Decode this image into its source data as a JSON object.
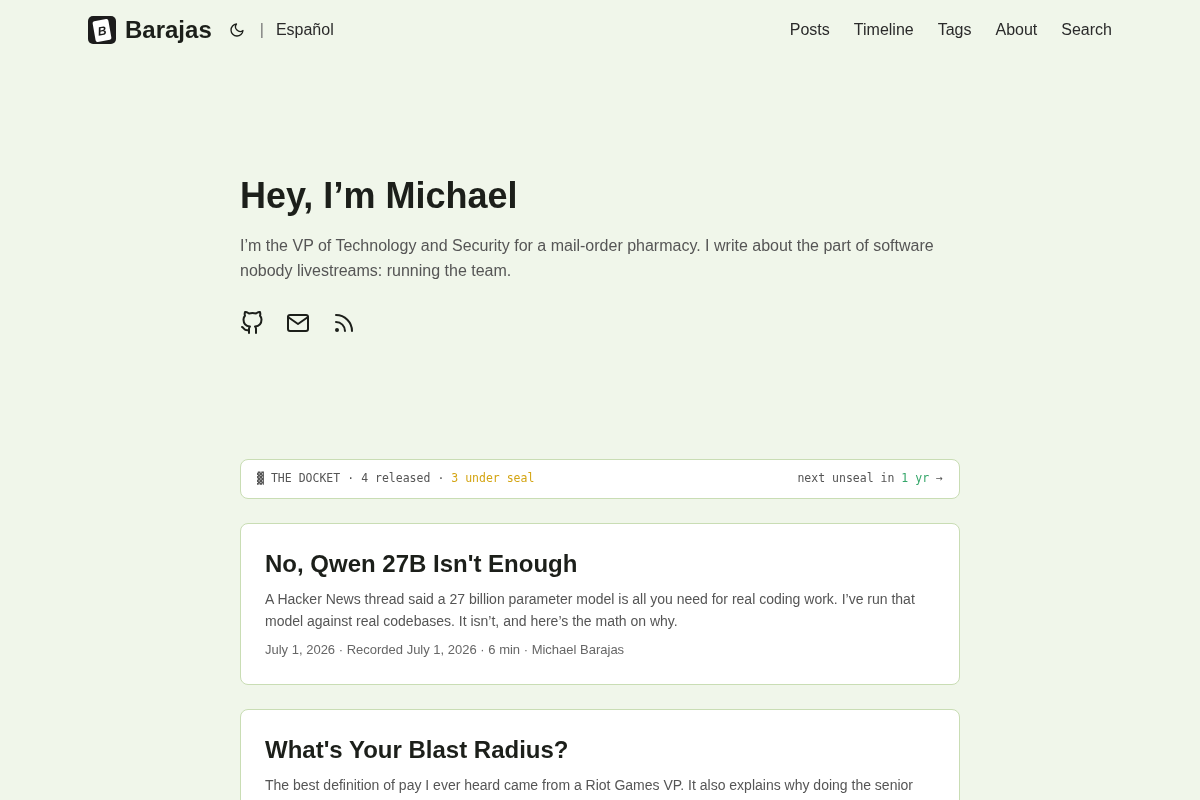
{
  "header": {
    "logo_letter": "B",
    "site_name": "Barajas",
    "separator": "|",
    "language": "Español",
    "nav": [
      "Posts",
      "Timeline",
      "Tags",
      "About",
      "Search"
    ]
  },
  "hero": {
    "heading": "Hey, I’m Michael",
    "intro": "I’m the VP of Technology and Security for a mail-order pharmacy. I write about the part of software nobody livestreams: running the team."
  },
  "docket": {
    "glyph": "▓",
    "separator": "·",
    "segments": [
      {
        "kind": "title",
        "text": "THE DOCKET"
      },
      {
        "kind": "released",
        "text": "4 released"
      },
      {
        "kind": "sealed",
        "text": "3 under seal"
      }
    ],
    "next_label": "next unseal in",
    "next_value": "1 yr",
    "arrow": "→"
  },
  "posts": [
    {
      "title": "No, Qwen 27B Isn't Enough",
      "description": "A Hacker News thread said a 27 billion parameter model is all you need for real coding work. I’ve run that model against real codebases. It isn’t, and here’s the math on why.",
      "meta": "July 1, 2026 · Recorded July 1, 2026 · 6 min · Michael Barajas"
    },
    {
      "title": "What's Your Blast Radius?",
      "description": "The best definition of pay I ever heard came from a Riot Games VP. It also explains why doing the senior"
    }
  ]
}
